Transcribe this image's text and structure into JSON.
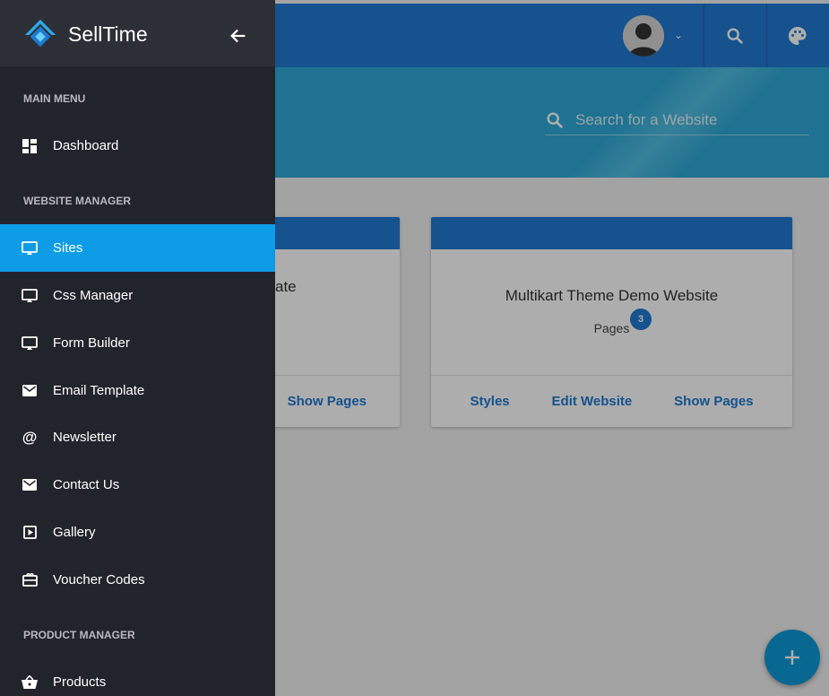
{
  "sidebar": {
    "brand": "SellTime",
    "sections": {
      "main_menu": "MAIN MENU",
      "website_manager": "WEBSITE MANAGER",
      "product_manager": "PRODUCT MANAGER"
    },
    "items": [
      {
        "label": "Dashboard",
        "icon": "dashboard-icon"
      },
      {
        "label": "Sites",
        "icon": "monitor-icon",
        "active": true
      },
      {
        "label": "Css Manager",
        "icon": "monitor-icon"
      },
      {
        "label": "Form Builder",
        "icon": "monitor-icon"
      },
      {
        "label": "Email Template",
        "icon": "envelope-icon"
      },
      {
        "label": "Newsletter",
        "icon": "at-sign-icon"
      },
      {
        "label": "Contact Us",
        "icon": "envelope-icon"
      },
      {
        "label": "Gallery",
        "icon": "play-square-icon"
      },
      {
        "label": "Voucher Codes",
        "icon": "gift-card-icon"
      },
      {
        "label": "Products",
        "icon": "basket-icon"
      }
    ]
  },
  "search": {
    "placeholder": "Search for a Website"
  },
  "cards": [
    {
      "title_partial": "ate",
      "action_show": "Show Pages"
    },
    {
      "title": "Multikart Theme Demo Website",
      "pages_label": "Pages",
      "pages_count": "3",
      "actions": {
        "styles": "Styles",
        "edit": "Edit Website",
        "show": "Show Pages"
      }
    }
  ],
  "colors": {
    "primary": "#1f7ad2",
    "accent": "#0e9ce6",
    "drawer_bg": "#22242b",
    "hero": "#2ea9d6"
  }
}
